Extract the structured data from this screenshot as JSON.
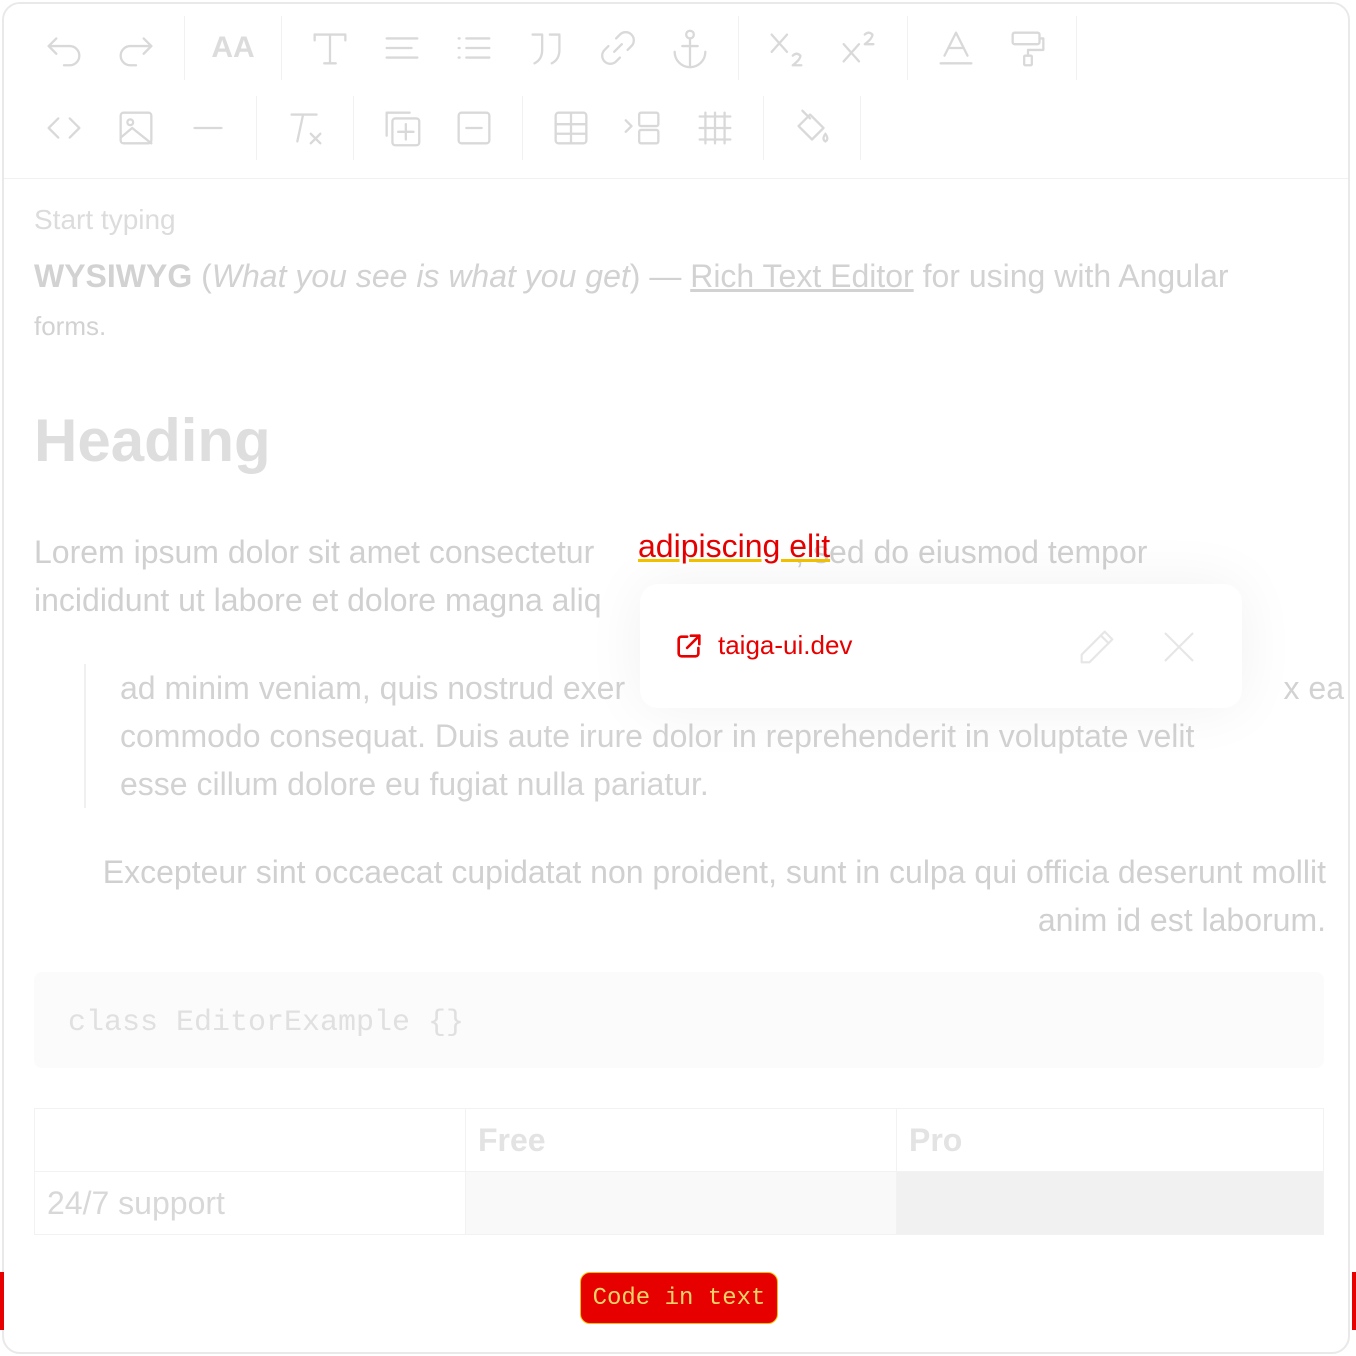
{
  "toolbar": {
    "font_size_label": "AA"
  },
  "editor": {
    "placeholder": "Start typing",
    "intro": {
      "bold": "WYSIWYG",
      "open_paren": " (",
      "italic": "What you see is what you get",
      "close_dash": ") — ",
      "link": "Rich Text Editor",
      "rest": " for using with Angular",
      "small": "forms."
    },
    "heading": "Heading",
    "paragraph_line1_start": "Lorem ipsum dolor sit amet consectetur ",
    "paragraph_link": "adipiscing elit",
    "paragraph_line1_end": ", sed do eiusmod tempor",
    "paragraph_line2": "incididunt ut labore et dolore magna aliq",
    "quote_line1": "ad minim veniam, quis nostrud exer",
    "quote_line1_end": "x ea",
    "quote_line2": "commodo consequat. Duis aute irure dolor in reprehenderit in voluptate velit",
    "quote_line3": "esse cillum dolore eu fugiat nulla pariatur.",
    "right_para": "Excepteur sint occaecat cupidatat non proident, sunt in culpa qui officia deserunt mollit anim id est laborum.",
    "code": "class EditorExample {}",
    "table": {
      "headers": [
        "",
        "Free",
        "Pro"
      ],
      "rows": [
        [
          "24/7 support",
          "",
          ""
        ]
      ]
    }
  },
  "link_popup": {
    "url": "taiga-ui.dev"
  },
  "code_pill": "Code in text",
  "colors": {
    "accent": "#e60000",
    "highlight": "#f2c200"
  }
}
